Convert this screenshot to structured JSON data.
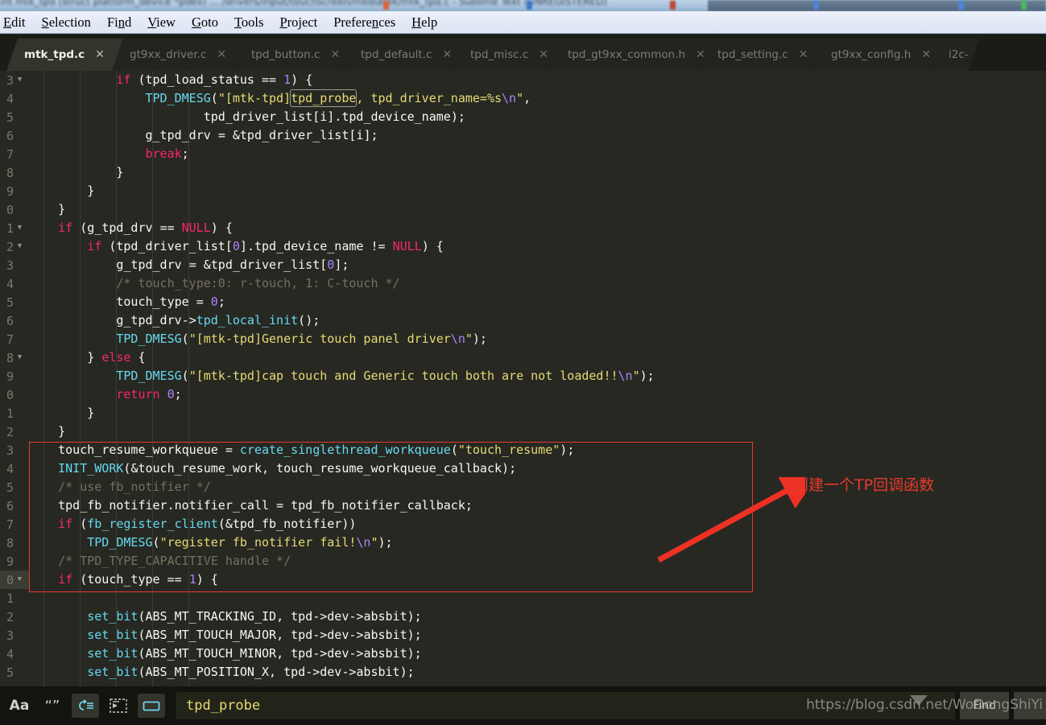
{
  "window": {
    "title_blurred": "int mtk_tpd (struct platform_device *pdev) ... /drivers/input/touchscreen/mediatek/mtk_tpd.c - Sublime Text (UNREGISTERED)"
  },
  "menu": {
    "items": [
      {
        "label": "Edit",
        "mnemonic": "E"
      },
      {
        "label": "Selection",
        "mnemonic": "S"
      },
      {
        "label": "Find",
        "mnemonic": "n"
      },
      {
        "label": "View",
        "mnemonic": "V"
      },
      {
        "label": "Goto",
        "mnemonic": "G"
      },
      {
        "label": "Tools",
        "mnemonic": "T"
      },
      {
        "label": "Project",
        "mnemonic": "P"
      },
      {
        "label": "Preferences",
        "mnemonic": "n"
      },
      {
        "label": "Help",
        "mnemonic": "H"
      }
    ]
  },
  "tabs": [
    {
      "label": "mtk_tpd.c",
      "active": true,
      "close": "✕"
    },
    {
      "label": "gt9xx_driver.c",
      "active": false,
      "close": "✕"
    },
    {
      "label": "tpd_button.c",
      "active": false,
      "close": "✕"
    },
    {
      "label": "tpd_default.c",
      "active": false,
      "close": "✕"
    },
    {
      "label": "tpd_misc.c",
      "active": false,
      "close": "✕"
    },
    {
      "label": "tpd_gt9xx_common.h",
      "active": false,
      "close": "✕"
    },
    {
      "label": "tpd_setting.c",
      "active": false,
      "close": "✕"
    },
    {
      "label": "gt9xx_config.h",
      "active": false,
      "close": "✕"
    },
    {
      "label": "i2c-",
      "active": false,
      "close": ""
    }
  ],
  "editor": {
    "gutter": [
      {
        "num": "3",
        "fold": "▼",
        "current": false
      },
      {
        "num": "4",
        "fold": "",
        "current": false
      },
      {
        "num": "5",
        "fold": "",
        "current": false
      },
      {
        "num": "6",
        "fold": "",
        "current": false
      },
      {
        "num": "7",
        "fold": "",
        "current": false
      },
      {
        "num": "8",
        "fold": "",
        "current": false
      },
      {
        "num": "9",
        "fold": "",
        "current": false
      },
      {
        "num": "0",
        "fold": "",
        "current": false
      },
      {
        "num": "1",
        "fold": "▼",
        "current": false
      },
      {
        "num": "2",
        "fold": "▼",
        "current": false
      },
      {
        "num": "3",
        "fold": "",
        "current": false
      },
      {
        "num": "4",
        "fold": "",
        "current": false
      },
      {
        "num": "5",
        "fold": "",
        "current": false
      },
      {
        "num": "6",
        "fold": "",
        "current": false
      },
      {
        "num": "7",
        "fold": "",
        "current": false
      },
      {
        "num": "8",
        "fold": "▼",
        "current": false
      },
      {
        "num": "9",
        "fold": "",
        "current": false
      },
      {
        "num": "0",
        "fold": "",
        "current": false
      },
      {
        "num": "1",
        "fold": "",
        "current": false
      },
      {
        "num": "2",
        "fold": "",
        "current": false
      },
      {
        "num": "3",
        "fold": "",
        "current": false
      },
      {
        "num": "4",
        "fold": "",
        "current": false
      },
      {
        "num": "5",
        "fold": "",
        "current": false
      },
      {
        "num": "6",
        "fold": "",
        "current": false
      },
      {
        "num": "7",
        "fold": "",
        "current": false
      },
      {
        "num": "8",
        "fold": "",
        "current": false
      },
      {
        "num": "9",
        "fold": "",
        "current": false
      },
      {
        "num": "0",
        "fold": "▼",
        "current": true
      },
      {
        "num": "1",
        "fold": "",
        "current": false
      },
      {
        "num": "2",
        "fold": "",
        "current": false
      },
      {
        "num": "3",
        "fold": "",
        "current": false
      },
      {
        "num": "4",
        "fold": "",
        "current": false
      },
      {
        "num": "5",
        "fold": "",
        "current": false
      }
    ],
    "lines": [
      "            if (tpd_load_status == 1) {",
      "                TPD_DMESG(\"[mtk-tpd]tpd_probe, tpd_driver_name=%s\\n\",",
      "                        tpd_driver_list[i].tpd_device_name);",
      "                g_tpd_drv = &tpd_driver_list[i];",
      "                break;",
      "            }",
      "        }",
      "    }",
      "    if (g_tpd_drv == NULL) {",
      "        if (tpd_driver_list[0].tpd_device_name != NULL) {",
      "            g_tpd_drv = &tpd_driver_list[0];",
      "            /* touch_type:0: r-touch, 1: C-touch */",
      "            touch_type = 0;",
      "            g_tpd_drv->tpd_local_init();",
      "            TPD_DMESG(\"[mtk-tpd]Generic touch panel driver\\n\");",
      "        } else {",
      "            TPD_DMESG(\"[mtk-tpd]cap touch and Generic touch both are not loaded!!\\n\");",
      "            return 0;",
      "        }",
      "    }",
      "    touch_resume_workqueue = create_singlethread_workqueue(\"touch_resume\");",
      "    INIT_WORK(&touch_resume_work, touch_resume_workqueue_callback);",
      "    /* use fb_notifier */",
      "    tpd_fb_notifier.notifier_call = tpd_fb_notifier_callback;",
      "    if (fb_register_client(&tpd_fb_notifier))",
      "        TPD_DMESG(\"register fb_notifier fail!\\n\");",
      "    /* TPD_TYPE_CAPACITIVE handle */",
      "    if (touch_type == 1) {",
      "",
      "        set_bit(ABS_MT_TRACKING_ID, tpd->dev->absbit);",
      "        set_bit(ABS_MT_TOUCH_MAJOR, tpd->dev->absbit);",
      "        set_bit(ABS_MT_TOUCH_MINOR, tpd->dev->absbit);",
      "        set_bit(ABS_MT_POSITION_X, tpd->dev->absbit);"
    ],
    "search_match_token": "tpd_probe"
  },
  "annotation": {
    "text": "创建一个TP回调函数",
    "color": "#e8392c",
    "arrow_color": "#ee3124"
  },
  "statusbar": {
    "buttons": [
      {
        "name": "case-sensitive-icon",
        "glyph": "Aa",
        "active": false
      },
      {
        "name": "whole-word-icon",
        "glyph": "“”",
        "active": false
      },
      {
        "name": "wrap-icon",
        "glyph": "",
        "active": true
      },
      {
        "name": "in-selection-icon",
        "glyph": "",
        "active": false
      },
      {
        "name": "highlight-results-icon",
        "glyph": "",
        "active": true
      }
    ],
    "find_value": "tpd_probe",
    "find_placeholder": "Find",
    "find_button": "Find",
    "watermark": "https://blog.csdn.net/WoDongShiYi"
  },
  "colors": {
    "bg": "#272822",
    "keyword": "#f92672",
    "function": "#66d9ef",
    "string": "#e6db74",
    "number": "#ae81ff",
    "comment": "#75715e",
    "plain": "#f8f8f2",
    "accent_red": "#e8392c"
  }
}
